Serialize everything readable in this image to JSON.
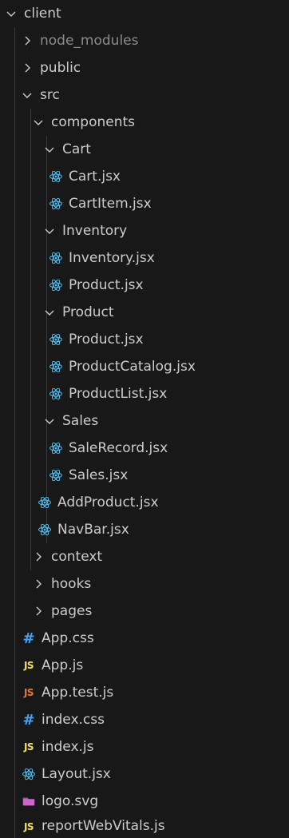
{
  "explorer": {
    "root": {
      "label": "client"
    },
    "folders": {
      "node_modules": "node_modules",
      "public": "public",
      "src": "src",
      "components": "components",
      "cart": "Cart",
      "inventory": "Inventory",
      "product": "Product",
      "sales": "Sales",
      "context": "context",
      "hooks": "hooks",
      "pages": "pages"
    },
    "files": {
      "cart_jsx": "Cart.jsx",
      "cartitem_jsx": "CartItem.jsx",
      "inventory_jsx": "Inventory.jsx",
      "inventory_product_jsx": "Product.jsx",
      "product_product_jsx": "Product.jsx",
      "productcatalog_jsx": "ProductCatalog.jsx",
      "productlist_jsx": "ProductList.jsx",
      "salerecord_jsx": "SaleRecord.jsx",
      "sales_jsx": "Sales.jsx",
      "addproduct_jsx": "AddProduct.jsx",
      "navbar_jsx": "NavBar.jsx",
      "app_css": "App.css",
      "app_js": "App.js",
      "app_test_js": "App.test.js",
      "index_css": "index.css",
      "index_js": "index.js",
      "layout_jsx": "Layout.jsx",
      "logo_svg": "logo.svg",
      "reportwebvitals_js": "reportWebVitals.js"
    },
    "icons": {
      "js_badge": "JS",
      "css_badge": "#"
    },
    "colors": {
      "background": "#181818",
      "text": "#cccccc",
      "dimmed_text": "#8c8c8c",
      "react_icon": "#4fc3f7",
      "js_icon": "#f1e05a",
      "test_js_icon": "#e37933",
      "css_icon": "#42a5f5",
      "svg_icon": "#cc66cc",
      "indent_guide": "#3a3a3a"
    }
  }
}
